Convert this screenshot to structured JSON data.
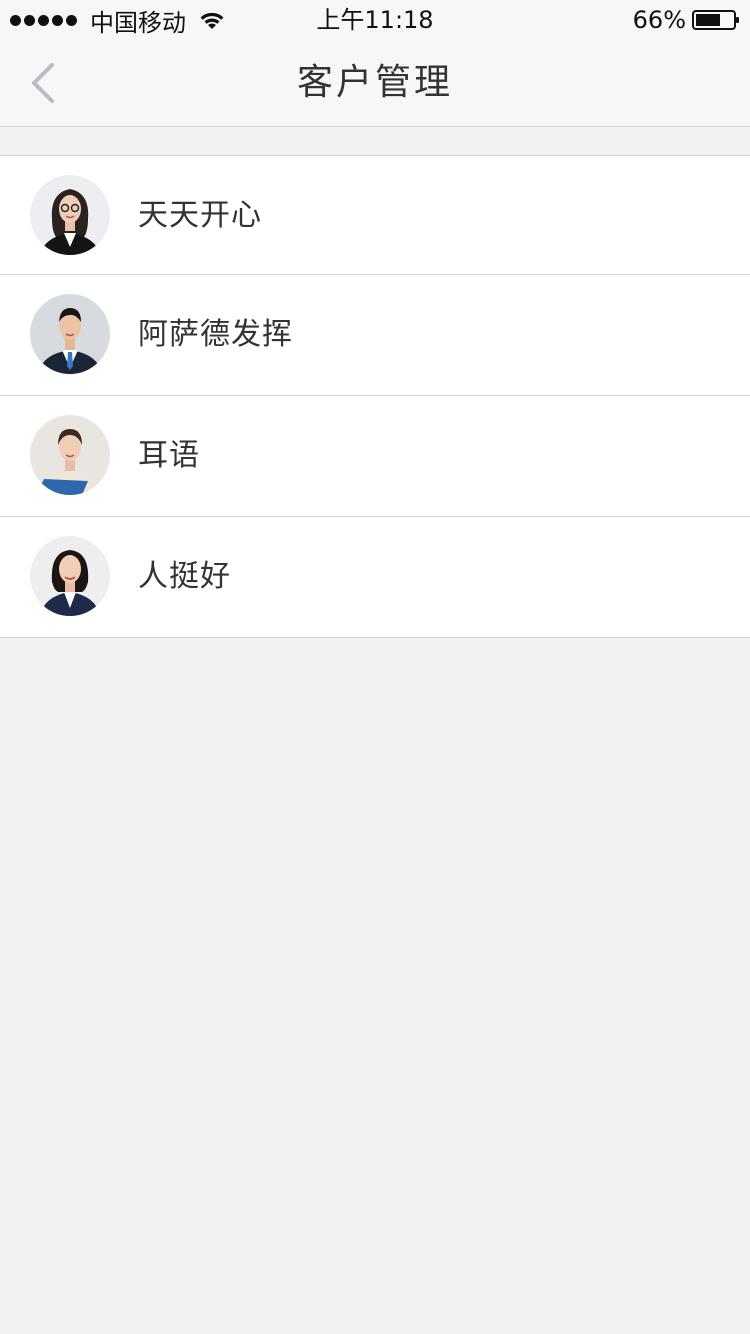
{
  "status_bar": {
    "carrier": "中国移动",
    "time": "上午11:18",
    "battery_percent": "66%",
    "battery_level": 0.66,
    "signal_bars": 5
  },
  "nav": {
    "title": "客户管理",
    "back_icon": "chevron-left-icon"
  },
  "colors": {
    "background": "#f2f2f2",
    "bar_background": "#f7f7f7",
    "divider": "#d4d4d4",
    "text": "#333333",
    "back_chevron": "#b9bcc4"
  },
  "customers": [
    {
      "name": "天天开心",
      "avatar": "avatar-woman-glasses"
    },
    {
      "name": "阿萨德发挥",
      "avatar": "avatar-man-suit"
    },
    {
      "name": "耳语",
      "avatar": "avatar-woman-folder"
    },
    {
      "name": "人挺好",
      "avatar": "avatar-woman-blazer"
    }
  ]
}
